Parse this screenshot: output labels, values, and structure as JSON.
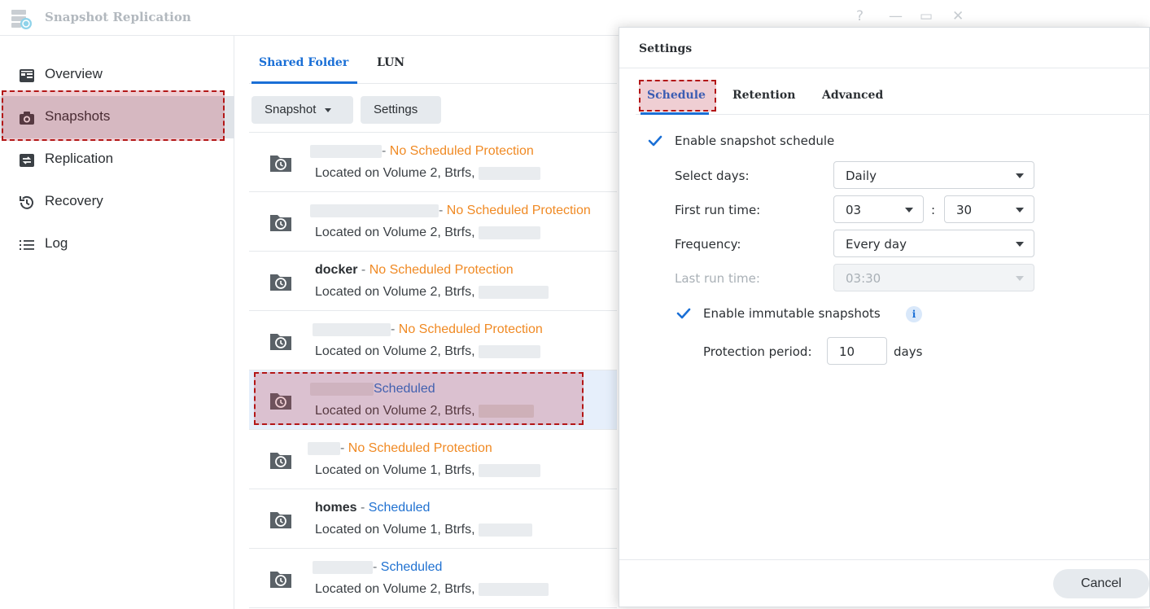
{
  "window": {
    "title": "Snapshot Replication",
    "controls": {
      "help": "?",
      "minimize": "—",
      "maximize": "▭",
      "close": "✕"
    }
  },
  "sidebar": {
    "items": [
      {
        "label": "Overview",
        "icon": "overview-icon"
      },
      {
        "label": "Snapshots",
        "icon": "camera-icon",
        "active": true
      },
      {
        "label": "Replication",
        "icon": "replication-icon"
      },
      {
        "label": "Recovery",
        "icon": "history-icon"
      },
      {
        "label": "Log",
        "icon": "list-icon"
      }
    ]
  },
  "main": {
    "tabs": [
      {
        "label": "Shared Folder",
        "active": true
      },
      {
        "label": "LUN"
      }
    ],
    "toolbar": {
      "snapshot_label": "Snapshot",
      "settings_label": "Settings"
    },
    "rows": [
      {
        "name": "",
        "separator": "- ",
        "status": "No Scheduled Protection",
        "status_type": "none",
        "location": "Located on Volume 2, Btrfs,"
      },
      {
        "name": "",
        "separator": "- ",
        "status": "No Scheduled Protection",
        "status_type": "none",
        "location": "Located on Volume 2, Btrfs,"
      },
      {
        "name": "docker",
        "separator": " - ",
        "status": "No Scheduled Protection",
        "status_type": "none",
        "location": "Located on Volume 2, Btrfs,"
      },
      {
        "name": "",
        "separator": "- ",
        "status": "No Scheduled Protection",
        "status_type": "none",
        "location": "Located on Volume 2, Btrfs,"
      },
      {
        "name": "",
        "separator": "",
        "status": "Scheduled",
        "status_type": "scheduled",
        "location": "Located on Volume 2, Btrfs,",
        "selected": true
      },
      {
        "name": "",
        "separator": "- ",
        "status": "No Scheduled Protection",
        "status_type": "none",
        "location": "Located on Volume 1, Btrfs,"
      },
      {
        "name": "homes",
        "separator": " - ",
        "status": "Scheduled",
        "status_type": "scheduled",
        "location": "Located on Volume 1, Btrfs,"
      },
      {
        "name": "",
        "separator": "- ",
        "status": "Scheduled",
        "status_type": "scheduled",
        "location": "Located on Volume 2, Btrfs,"
      }
    ]
  },
  "dialog": {
    "title": "Settings",
    "tabs": [
      {
        "label": "Schedule",
        "active": true
      },
      {
        "label": "Retention"
      },
      {
        "label": "Advanced"
      }
    ],
    "enable_schedule_label": "Enable snapshot schedule",
    "select_days": {
      "label": "Select days:",
      "value": "Daily"
    },
    "first_run": {
      "label": "First run time:",
      "hour": "03",
      "colon": ":",
      "minute": "30"
    },
    "frequency": {
      "label": "Frequency:",
      "value": "Every day"
    },
    "last_run": {
      "label": "Last run time:",
      "value": "03:30"
    },
    "immutable_label": "Enable immutable snapshots",
    "info_glyph": "i",
    "protection": {
      "label": "Protection period:",
      "value": "10",
      "unit": "days"
    },
    "cancel_label": "Cancel"
  },
  "colors": {
    "accent": "#1a6fd6",
    "warning": "#f08a24",
    "highlight_border": "#b31717"
  }
}
